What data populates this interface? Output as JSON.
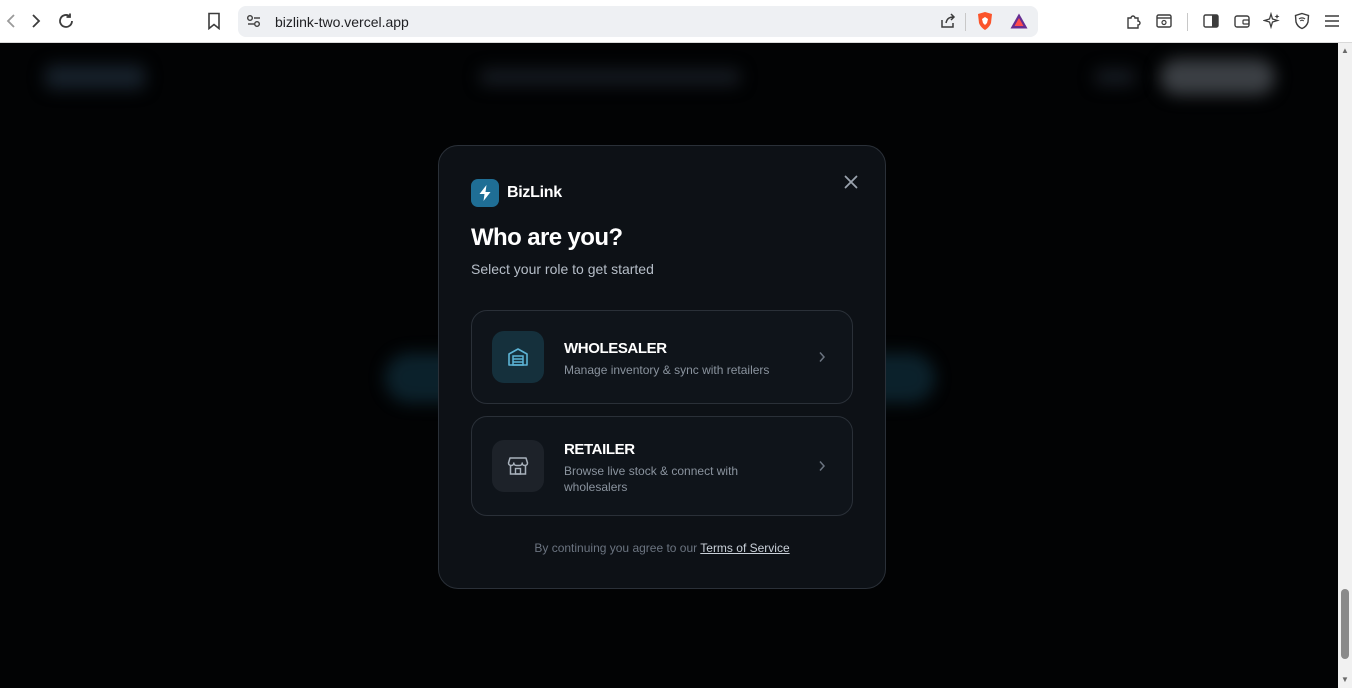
{
  "browser": {
    "url": "bizlink-two.vercel.app"
  },
  "modal": {
    "brand_name": "BizLink",
    "title": "Who are you?",
    "subtitle": "Select your role to get started",
    "roles": [
      {
        "title": "WHOLESALER",
        "description": "Manage inventory & sync with retailers",
        "icon": "warehouse-icon"
      },
      {
        "title": "RETAILER",
        "description": "Browse live stock & connect with wholesalers",
        "icon": "store-icon"
      }
    ],
    "terms_prefix": "By continuing you agree to our ",
    "terms_link": "Terms of Service"
  },
  "colors": {
    "accent": "#1f6e95",
    "modal_bg": "#0d1116",
    "page_bg": "#020304"
  }
}
